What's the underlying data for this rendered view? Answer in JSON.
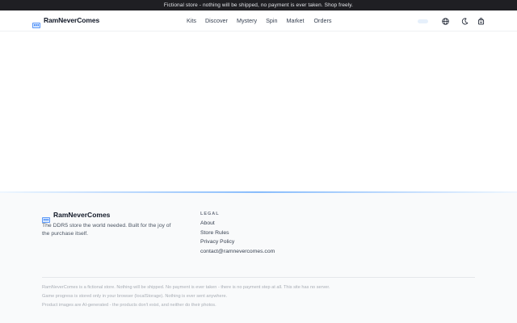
{
  "banner": {
    "text": "Fictional store - nothing will be shipped, no payment is ever taken. Shop freely."
  },
  "header": {
    "brand": "RamNeverComes",
    "nav": [
      "Kits",
      "Discover",
      "Mystery",
      "Spin",
      "Market",
      "Orders"
    ],
    "icons": [
      "globe-icon",
      "moon-icon",
      "cart-icon"
    ]
  },
  "footer": {
    "brand": "RamNeverComes",
    "tagline": "The DDR5 store the world needed. Built for the joy of the purchase itself.",
    "legal_title": "LEGAL",
    "legal_links": [
      "About",
      "Store Rules",
      "Privacy Policy",
      "contact@ramnevercomes.com"
    ],
    "notes": [
      "RamNeverComes is a fictional store. Nothing will be shipped. No payment is ever taken - there is no payment step at all. This site has no server.",
      "Game progress is stored only in your browser (localStorage). Nothing is ever sent anywhere.",
      "Product images are AI-generated - the products don't exist, and neither do their photos."
    ]
  },
  "colors": {
    "banner_bg": "#1f1f23",
    "accent": "#60a5fa",
    "brand_icon": "#3b82f6"
  }
}
